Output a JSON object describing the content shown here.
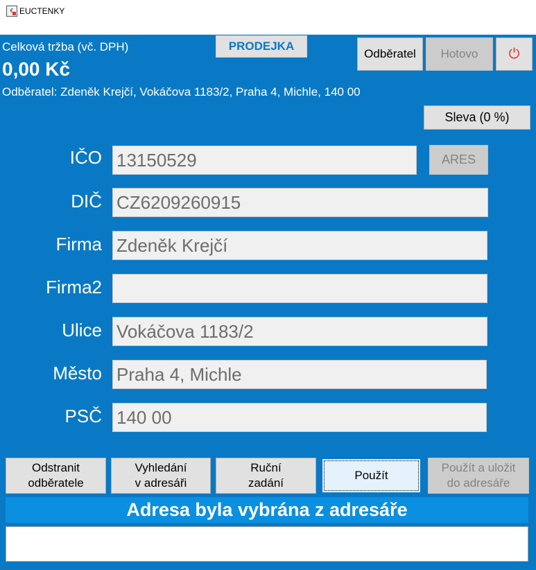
{
  "window": {
    "title": "EUCTENKY",
    "icon": "euctenky-app-icon"
  },
  "header": {
    "revenue_label": "Celková tržba (vč. DPH)",
    "revenue_value": "0,00 Kč",
    "customer_line": "Odběratel: Zdeněk Krejčí, Vokáčova 1183/2, Praha 4, Michle, 140 00",
    "doc_type": "PRODEJKA"
  },
  "toolbar": {
    "odberatel": "Odběratel",
    "hotovo": "Hotovo",
    "power_icon": "⏻",
    "sleva": "Sleva (0 %)"
  },
  "form": {
    "ico": {
      "label": "IČO",
      "value": "13150529"
    },
    "ares": "ARES",
    "dic": {
      "label": "DIČ",
      "value": "CZ6209260915"
    },
    "firma": {
      "label": "Firma",
      "value": "Zdeněk Krejčí"
    },
    "firma2": {
      "label": "Firma2",
      "value": ""
    },
    "ulice": {
      "label": "Ulice",
      "value": "Vokáčova 1183/2"
    },
    "mesto": {
      "label": "Město",
      "value": "Praha 4, Michle"
    },
    "psc": {
      "label": "PSČ",
      "value": "140 00"
    }
  },
  "actions": {
    "remove": [
      "Odstranit",
      "odběratele"
    ],
    "search": [
      "Vyhledání",
      "v adresáři"
    ],
    "manual": [
      "Ruční",
      "zadání"
    ],
    "use": "Použít",
    "use_save": [
      "Použít a uložit",
      "do adresáře"
    ]
  },
  "status": "Adresa byla vybrána z adresáře",
  "colors": {
    "background": "#0a79c5",
    "status_bar": "#0b8fe0",
    "power": "#e0302a"
  }
}
